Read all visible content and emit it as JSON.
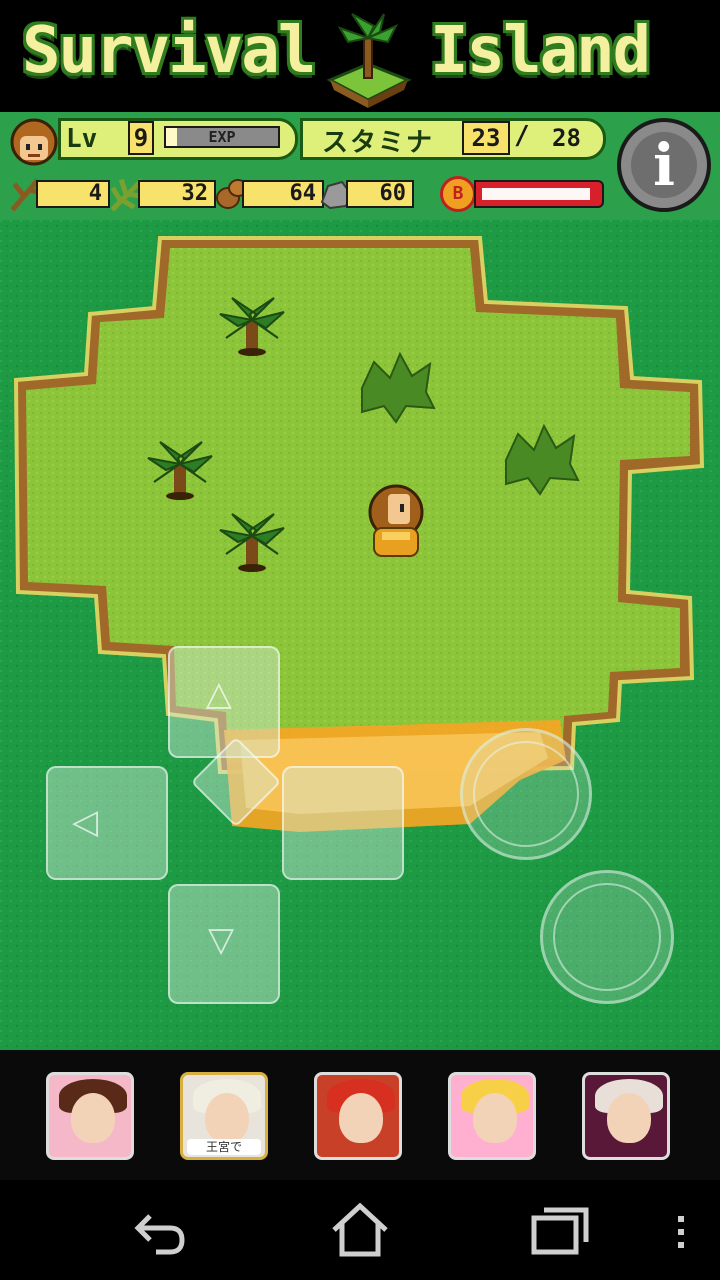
{
  "title": {
    "word1": "Survival",
    "word2": "Island"
  },
  "hud": {
    "level_label": "Lv",
    "level_value": "9",
    "exp_label": "EXP",
    "exp_fraction": 0.1,
    "stamina_label": "スタミナ",
    "stamina_current": "23",
    "stamina_separator": "/",
    "stamina_max": "28",
    "resources": [
      {
        "icon": "branch-icon",
        "value": "4"
      },
      {
        "icon": "leaf-icon",
        "value": "32"
      },
      {
        "icon": "nut-icon",
        "value": "64"
      },
      {
        "icon": "stone-icon",
        "value": "60"
      }
    ],
    "bonus_badge": "B",
    "bonus_fraction": 0.95
  },
  "controls": {
    "up_arrow": "◁",
    "left_arrow": "◁",
    "down_arrow": "▽"
  },
  "ads": [
    {
      "name": "ad-romance-game-1",
      "caption": ""
    },
    {
      "name": "ad-romance-game-2",
      "caption": "王宮で"
    },
    {
      "name": "ad-rpg-game",
      "caption": ""
    },
    {
      "name": "ad-girls-game",
      "caption": ""
    },
    {
      "name": "ad-dark-fantasy-game",
      "caption": ""
    }
  ],
  "colors": {
    "ocean": "#1f9a44",
    "grass": "#8cc43a",
    "sand_shore": "#a0692a",
    "fire": "#f5a524",
    "hud_bg": "#2ca04a",
    "hud_panel": "#dff07a",
    "value_box": "#f7e26b"
  }
}
